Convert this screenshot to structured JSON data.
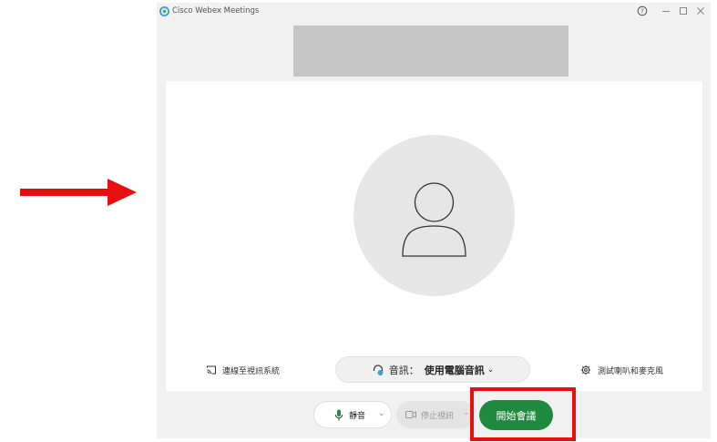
{
  "window": {
    "title": "Cisco Webex Meetings",
    "controls": {
      "help": "help-icon",
      "minimize": "minimize-icon",
      "maximize": "maximize-icon",
      "close": "close-icon"
    }
  },
  "preview": {
    "cast_label": "連線至視訊系統",
    "audio_label": "音訊：",
    "audio_value": "使用電腦音訊",
    "audio_chevron": "⌄",
    "test_label": "測試喇叭和麥克風"
  },
  "controls": {
    "mute_label": "靜音",
    "mute_chevron": "⌄",
    "video_label": "停止視訊",
    "video_chevron": "⌄",
    "start_label": "開始會議"
  },
  "colors": {
    "start_button": "#1f8a3f",
    "annotation_red": "#e8100f",
    "window_bg": "#f1f1f1",
    "avatar_bg": "#e6e6e6"
  }
}
